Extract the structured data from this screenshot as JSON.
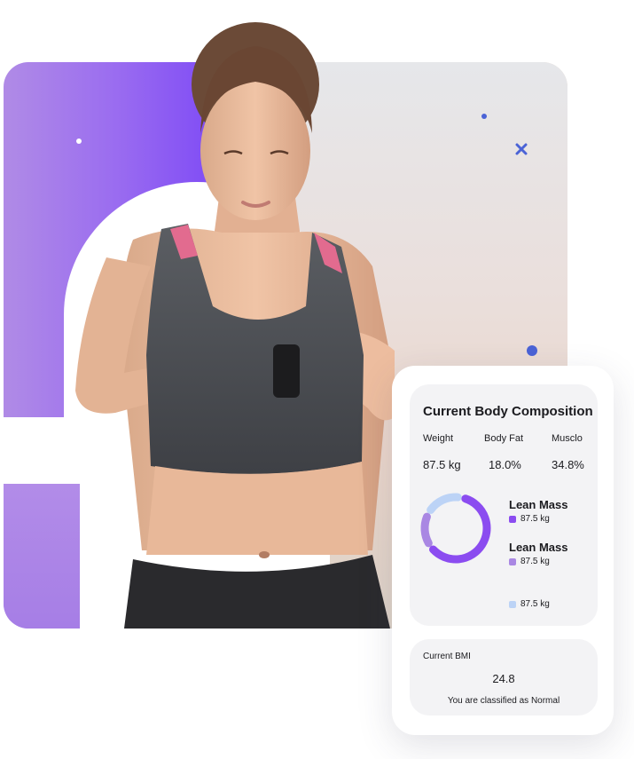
{
  "colors": {
    "purple": "#8b4cf0",
    "lilac": "#a987e3",
    "light_blue": "#bcd3f6",
    "dark_blue_accent": "#4b63d6"
  },
  "card": {
    "title": "Current Body Composition",
    "stats": [
      {
        "label": "Weight",
        "value": "87.5 kg"
      },
      {
        "label": "Body Fat",
        "value": "18.0%"
      },
      {
        "label": "Musclo",
        "value": "34.8%"
      }
    ],
    "legend": [
      {
        "title": "Lean Mass",
        "value": "87.5 kg",
        "color": "#8b4cf0"
      },
      {
        "title": "Lean Mass",
        "value": "87.5 kg",
        "color": "#a987e3"
      },
      {
        "title": "",
        "value": "87.5 kg",
        "color": "#bcd3f6"
      }
    ],
    "donut_fractions": [
      0.62,
      0.18,
      0.2
    ]
  },
  "bmi": {
    "label": "Current BMI",
    "value": "24.8",
    "note": "You are classified as Normal"
  },
  "icons": [
    "sparkle-dot",
    "cross-icon",
    "fitness-tracker"
  ]
}
